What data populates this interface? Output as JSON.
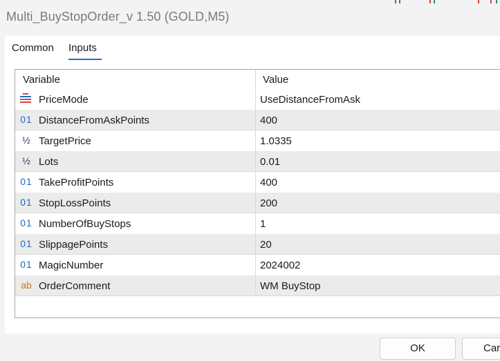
{
  "window": {
    "title": "Multi_BuyStopOrder_v 1.50 (GOLD,M5)"
  },
  "tabs": [
    {
      "label": "Common",
      "active": false
    },
    {
      "label": "Inputs",
      "active": true
    }
  ],
  "grid": {
    "headers": {
      "variable": "Variable",
      "value": "Value"
    },
    "rows": [
      {
        "icon": "enum-icon",
        "type": "enum",
        "name": "PriceMode",
        "value": "UseDistanceFromAsk"
      },
      {
        "icon": "integer-icon",
        "type": "int",
        "glyph": "01",
        "name": "DistanceFromAskPoints",
        "value": "400"
      },
      {
        "icon": "double-icon",
        "type": "double",
        "glyph": "½",
        "name": "TargetPrice",
        "value": "1.0335"
      },
      {
        "icon": "double-icon",
        "type": "double",
        "glyph": "½",
        "name": "Lots",
        "value": "0.01"
      },
      {
        "icon": "integer-icon",
        "type": "int",
        "glyph": "01",
        "name": "TakeProfitPoints",
        "value": "400"
      },
      {
        "icon": "integer-icon",
        "type": "int",
        "glyph": "01",
        "name": "StopLossPoints",
        "value": "200"
      },
      {
        "icon": "integer-icon",
        "type": "int",
        "glyph": "01",
        "name": "NumberOfBuyStops",
        "value": "1"
      },
      {
        "icon": "integer-icon",
        "type": "int",
        "glyph": "01",
        "name": "SlippagePoints",
        "value": "20"
      },
      {
        "icon": "integer-icon",
        "type": "int",
        "glyph": "01",
        "name": "MagicNumber",
        "value": "2024002"
      },
      {
        "icon": "string-icon",
        "type": "string",
        "glyph": "ab",
        "name": "OrderComment",
        "value": "WM BuyStop"
      }
    ]
  },
  "buttons": {
    "ok": "OK",
    "cancel": "Car"
  },
  "colors": {
    "accent": "#1d6fc7",
    "int_icon": "#1c6cc2",
    "string_icon": "#c47c12",
    "enum_red": "#d9433b",
    "enum_blue": "#1c6cc2"
  }
}
